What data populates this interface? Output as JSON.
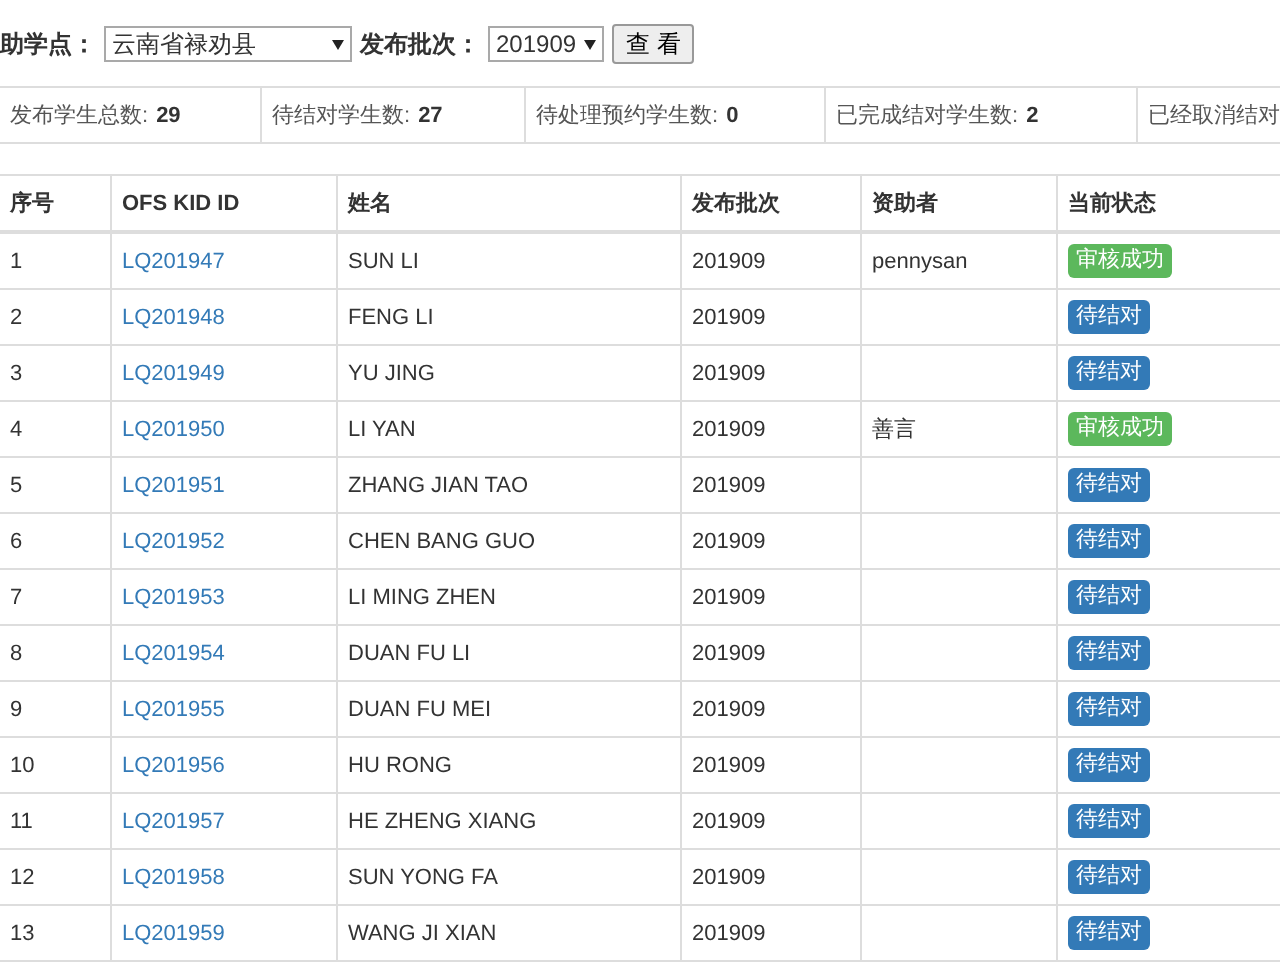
{
  "filters": {
    "site_label": "助学点：",
    "site_value": "云南省禄劝县",
    "batch_label": "发布批次：",
    "batch_value": "201909",
    "search_button": "查 看"
  },
  "stats": [
    {
      "label": "发布学生总数:",
      "value": "29"
    },
    {
      "label": "待结对学生数:",
      "value": "27"
    },
    {
      "label": "待处理预约学生数:",
      "value": "0"
    },
    {
      "label": "已完成结对学生数:",
      "value": "2"
    },
    {
      "label": "已经取消结对"
    }
  ],
  "table": {
    "columns": [
      "序号",
      "OFS KID ID",
      "姓名",
      "发布批次",
      "资助者",
      "当前状态"
    ],
    "rows": [
      {
        "no": "1",
        "id": "LQ201947",
        "name": "SUN LI",
        "batch": "201909",
        "sponsor": "pennysan",
        "status": {
          "kind": "success",
          "text": "审核成功"
        }
      },
      {
        "no": "2",
        "id": "LQ201948",
        "name": "FENG LI",
        "batch": "201909",
        "status": {
          "kind": "pending",
          "text": "待结对"
        }
      },
      {
        "no": "3",
        "id": "LQ201949",
        "name": "YU JING",
        "batch": "201909",
        "status": {
          "kind": "pending",
          "text": "待结对"
        }
      },
      {
        "no": "4",
        "id": "LQ201950",
        "name": "LI YAN",
        "batch": "201909",
        "sponsor": "善言",
        "status": {
          "kind": "success",
          "text": "审核成功"
        }
      },
      {
        "no": "5",
        "id": "LQ201951",
        "name": "ZHANG JIAN TAO",
        "batch": "201909",
        "status": {
          "kind": "pending",
          "text": "待结对"
        }
      },
      {
        "no": "6",
        "id": "LQ201952",
        "name": "CHEN BANG GUO",
        "batch": "201909",
        "status": {
          "kind": "pending",
          "text": "待结对"
        }
      },
      {
        "no": "7",
        "id": "LQ201953",
        "name": "LI MING ZHEN",
        "batch": "201909",
        "status": {
          "kind": "pending",
          "text": "待结对"
        }
      },
      {
        "no": "8",
        "id": "LQ201954",
        "name": "DUAN FU LI",
        "batch": "201909",
        "status": {
          "kind": "pending",
          "text": "待结对"
        }
      },
      {
        "no": "9",
        "id": "LQ201955",
        "name": "DUAN FU MEI",
        "batch": "201909",
        "status": {
          "kind": "pending",
          "text": "待结对"
        }
      },
      {
        "no": "10",
        "id": "LQ201956",
        "name": "HU RONG",
        "batch": "201909",
        "status": {
          "kind": "pending",
          "text": "待结对"
        }
      },
      {
        "no": "11",
        "id": "LQ201957",
        "name": "HE ZHENG XIANG",
        "batch": "201909",
        "status": {
          "kind": "pending",
          "text": "待结对"
        }
      },
      {
        "no": "12",
        "id": "LQ201958",
        "name": "SUN YONG FA",
        "batch": "201909",
        "status": {
          "kind": "pending",
          "text": "待结对"
        }
      },
      {
        "no": "13",
        "id": "LQ201959",
        "name": "WANG JI XIAN",
        "batch": "201909",
        "status": {
          "kind": "pending",
          "text": "待结对"
        }
      }
    ]
  }
}
